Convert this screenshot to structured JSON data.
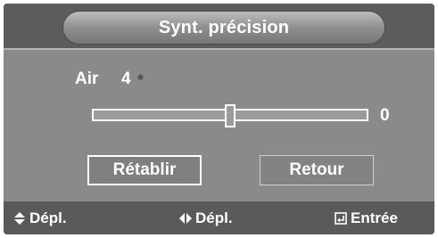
{
  "menu": {
    "title": "Synt. précision"
  },
  "setting": {
    "label": "Air",
    "value": "4",
    "marker": "*"
  },
  "slider": {
    "value_text": "0",
    "position_fraction": 0.5
  },
  "buttons": {
    "reset_label": "Rétablir",
    "back_label": "Retour"
  },
  "footer": {
    "move_vertical_label": "Dépl.",
    "move_horizontal_label": "Dépl.",
    "enter_label": "Entrée",
    "icons": [
      "up-down-arrows-icon",
      "left-right-arrows-icon",
      "enter-icon"
    ]
  },
  "colors": {
    "panel": "#8a8a8a",
    "header": "#5c5c5c",
    "footer": "#5a5a5a",
    "text": "#ffffff"
  }
}
